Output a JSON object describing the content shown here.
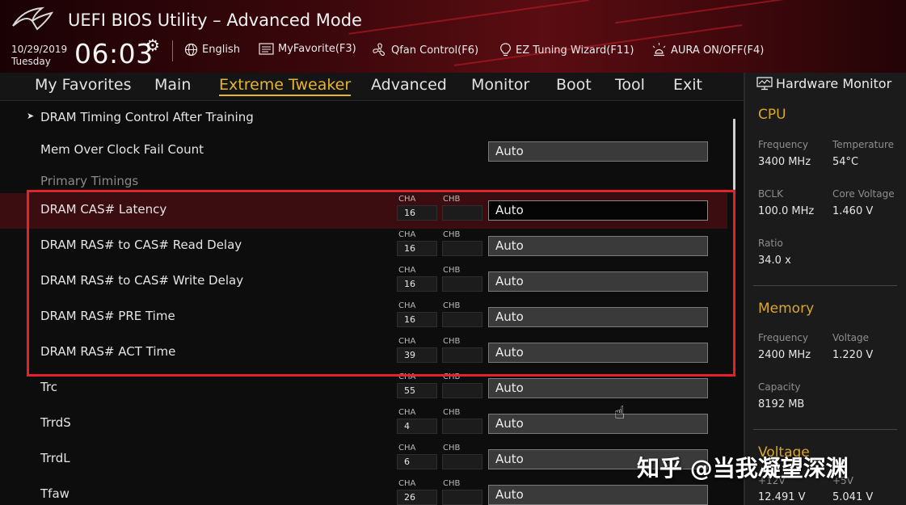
{
  "header": {
    "title": "UEFI BIOS Utility – Advanced Mode",
    "date": "10/29/2019",
    "weekday": "Tuesday",
    "time": "06:03",
    "tools": [
      {
        "label": "English",
        "icon": "globe-icon"
      },
      {
        "label": "MyFavorite(F3)",
        "icon": "favorite-list-icon"
      },
      {
        "label": "Qfan Control(F6)",
        "icon": "fan-icon"
      },
      {
        "label": "EZ Tuning Wizard(F11)",
        "icon": "lightbulb-icon"
      },
      {
        "label": "AURA ON/OFF(F4)",
        "icon": "aura-light-icon"
      }
    ]
  },
  "nav": {
    "tabs": [
      {
        "label": "My Favorites"
      },
      {
        "label": "Main"
      },
      {
        "label": "Extreme Tweaker",
        "active": true
      },
      {
        "label": "Advanced"
      },
      {
        "label": "Monitor"
      },
      {
        "label": "Boot"
      },
      {
        "label": "Tool"
      },
      {
        "label": "Exit"
      }
    ]
  },
  "main": {
    "submenu_label": "DRAM Timing Control After Training",
    "fail_count": {
      "label": "Mem Over Clock Fail Count",
      "value": "Auto"
    },
    "section_label": "Primary Timings",
    "cha_label": "CHA",
    "chb_label": "CHB",
    "rows": [
      {
        "label": "DRAM CAS# Latency",
        "cha": "16",
        "chb": "",
        "value": "Auto"
      },
      {
        "label": "DRAM RAS# to CAS# Read Delay",
        "cha": "16",
        "chb": "",
        "value": "Auto"
      },
      {
        "label": "DRAM RAS# to CAS# Write Delay",
        "cha": "16",
        "chb": "",
        "value": "Auto"
      },
      {
        "label": "DRAM RAS# PRE Time",
        "cha": "16",
        "chb": "",
        "value": "Auto"
      },
      {
        "label": "DRAM RAS# ACT Time",
        "cha": "39",
        "chb": "",
        "value": "Auto"
      },
      {
        "label": "Trc",
        "cha": "55",
        "chb": "",
        "value": "Auto"
      },
      {
        "label": "TrrdS",
        "cha": "4",
        "chb": "",
        "value": "Auto"
      },
      {
        "label": "TrrdL",
        "cha": "6",
        "chb": "",
        "value": "Auto"
      },
      {
        "label": "Tfaw",
        "cha": "26",
        "chb": "",
        "value": "Auto"
      }
    ]
  },
  "hw": {
    "title": "Hardware Monitor",
    "cpu": {
      "label": "CPU",
      "freq_k": "Frequency",
      "freq_v": "3400 MHz",
      "temp_k": "Temperature",
      "temp_v": "54°C",
      "bclk_k": "BCLK",
      "bclk_v": "100.0 MHz",
      "cv_k": "Core Voltage",
      "cv_v": "1.460 V",
      "ratio_k": "Ratio",
      "ratio_v": "34.0 x"
    },
    "memory": {
      "label": "Memory",
      "freq_k": "Frequency",
      "freq_v": "2400 MHz",
      "volt_k": "Voltage",
      "volt_v": "1.220 V",
      "cap_k": "Capacity",
      "cap_v": "8192 MB"
    },
    "voltage": {
      "label": "Voltage",
      "v12_k": "+12V",
      "v12_v": "12.491 V",
      "v5_k": "+5V",
      "v5_v": "5.041 V"
    }
  },
  "watermark": "知乎 @当我凝望深渊",
  "colors": {
    "accent": "#e6b42a",
    "highlight": "#e8202a",
    "selected_row": "#3b0d10"
  }
}
